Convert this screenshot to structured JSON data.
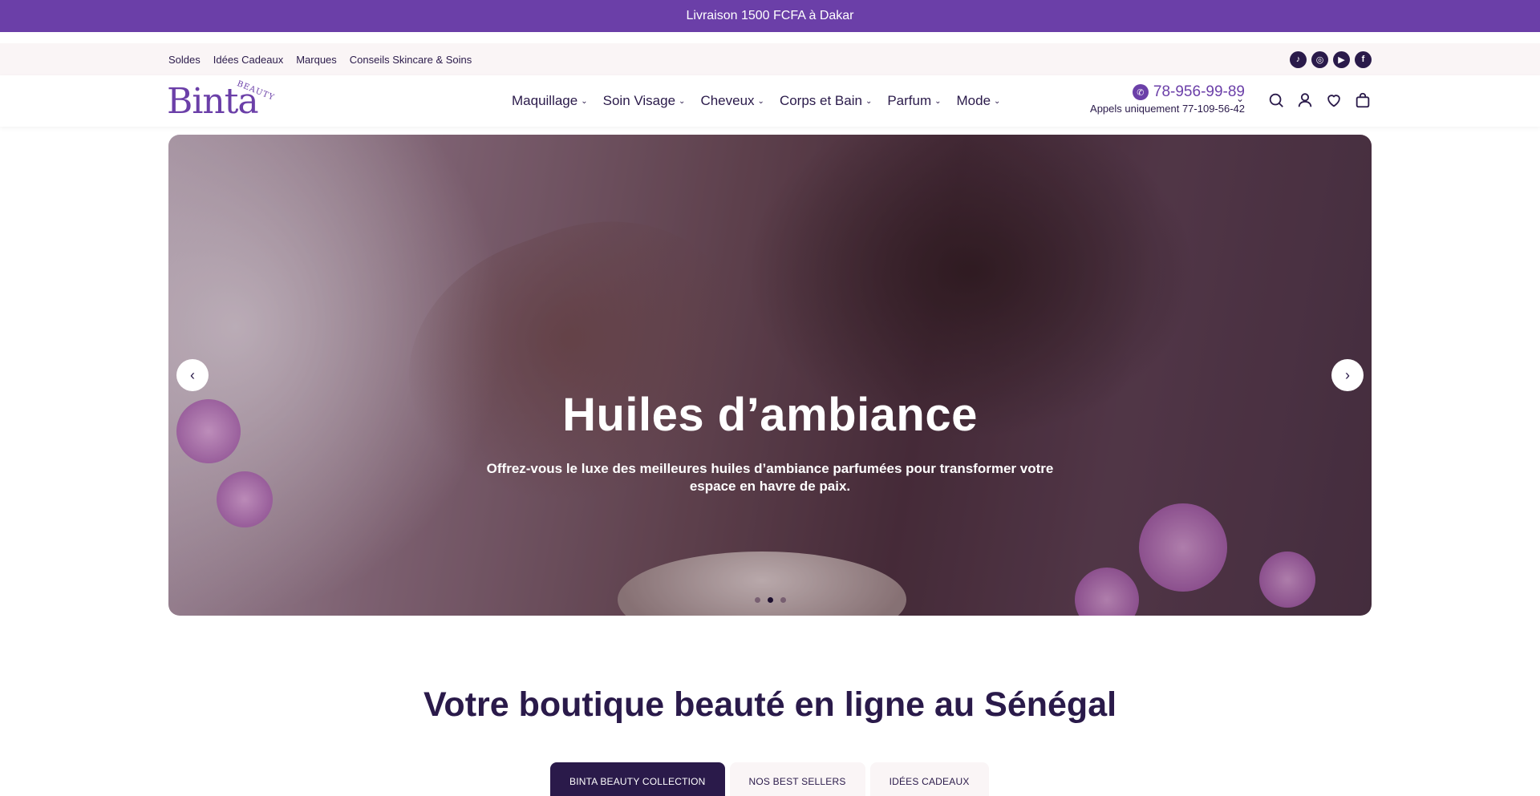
{
  "announcement": "Livraison 1500 FCFA à Dakar",
  "utility": {
    "links": [
      "Soldes",
      "Idées Cadeaux",
      "Marques",
      "Conseils Skincare & Soins"
    ],
    "social": [
      "tiktok-icon",
      "instagram-icon",
      "youtube-icon",
      "facebook-icon"
    ]
  },
  "header": {
    "logo_word": "Binta",
    "logo_sub": "BEAUTY",
    "nav": [
      "Maquillage",
      "Soin Visage",
      "Cheveux",
      "Corps et Bain",
      "Parfum",
      "Mode"
    ],
    "phone": "78-956-99-89",
    "phone_note": "Appels uniquement 77-109-56-42",
    "icons": [
      "search-icon",
      "account-icon",
      "wishlist-icon",
      "cart-icon"
    ]
  },
  "hero": {
    "title": "Huiles d’ambiance",
    "subtitle": "Offrez-vous le luxe des meilleures huiles d’ambiance parfumées pour transformer votre espace en havre de paix.",
    "slides": 3,
    "active_slide": 2
  },
  "section": {
    "title": "Votre boutique beauté en ligne au Sénégal",
    "tabs": [
      "BINTA BEAUTY COLLECTION",
      "NOS BEST SELLERS",
      "IDÉES CADEAUX"
    ],
    "active_tab": 0
  },
  "colors": {
    "brand": "#6b3fa8",
    "dark": "#2a1a4a",
    "utility_bg": "#faf5f6"
  }
}
